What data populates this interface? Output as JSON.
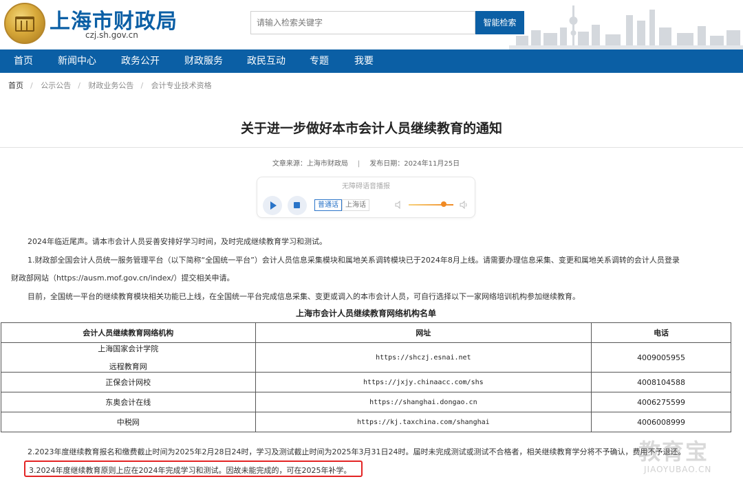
{
  "header": {
    "site_title": "上海市财政局",
    "site_domain": "czj.sh.gov.cn",
    "search_placeholder": "请输入检索关键字",
    "search_button": "智能检索"
  },
  "nav": {
    "items": [
      "首页",
      "新闻中心",
      "政务公开",
      "财政服务",
      "政民互动",
      "专题",
      "我要"
    ]
  },
  "breadcrumb": [
    "首页",
    "公示公告",
    "财政业务公告",
    "会计专业技术资格"
  ],
  "article": {
    "title": "关于进一步做好本市会计人员继续教育的通知",
    "source": "文章来源：上海市财政局",
    "meta_divider": "|",
    "publish_date": "发布日期：2024年11月25日"
  },
  "player": {
    "title": "无障碍语音播报",
    "lang_mandarin": "普通话",
    "lang_shanghainese": "上海话",
    "volume_level": 0.75
  },
  "paragraphs": {
    "p1": "2024年临近尾声。请本市会计人员妥善安排好学习时间，及时完成继续教育学习和测试。",
    "p2a": "1.财政部全国会计人员统一服务管理平台（以下简称“全国统一平台”）会计人员信息采集模块和属地关系调转模块已于2024年8月上线。请需要办理信息采集、变更和属地关系调转的会计人员登录",
    "p2b": "财政部网站（https://ausm.mof.gov.cn/index/）提交相关申请。",
    "p3": "目前，全国统一平台的继续教育模块相关功能已上线，在全国统一平台完成信息采集、变更或调入的本市会计人员，可自行选择以下一家网络培训机构参加继续教育。",
    "p4": "2.2023年度继续教育报名和缴费截止时间为2025年2月28日24时，学习及测试截止时间为2025年3月31日24时。届时未完成测试或测试不合格者，相关继续教育学分将不予确认，费用不予退还。",
    "p5": "3.2024年度继续教育原则上应在2024年完成学习和测试。因故未能完成的，可在2025年补学。"
  },
  "table": {
    "caption": "上海市会计人员继续教育网络机构名单",
    "headers": [
      "会计人员继续教育网络机构",
      "网址",
      "电话"
    ],
    "rows": [
      {
        "name_line1": "上海国家会计学院",
        "name_line2": "远程教育网",
        "url": "https://shczj.esnai.net",
        "phone": "4009005955"
      },
      {
        "name": "正保会计网校",
        "url": "https://jxjy.chinaacc.com/shs",
        "phone": "4008104588"
      },
      {
        "name": "东奥会计在线",
        "url": "https://shanghai.dongao.cn",
        "phone": "4006275599"
      },
      {
        "name": "中税网",
        "url": "https://kj.taxchina.com/shanghai",
        "phone": "4006008999"
      }
    ]
  },
  "watermark": {
    "main": "教育宝",
    "sub": "JIAOYUBAO.CN"
  }
}
